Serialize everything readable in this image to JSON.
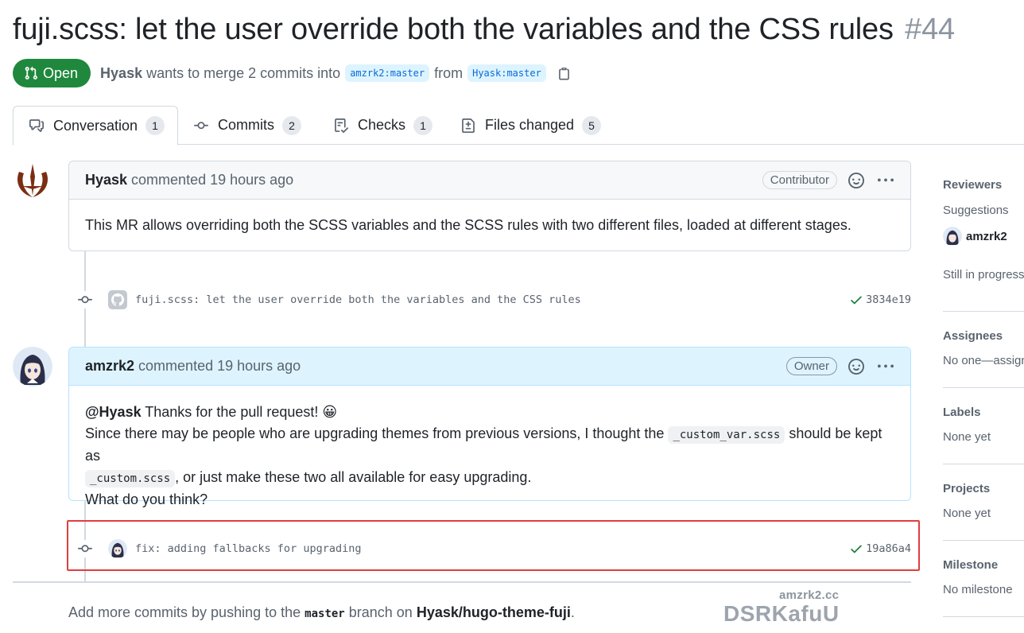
{
  "pr": {
    "title": "fuji.scss: let the user override both the variables and the CSS rules",
    "number": "#44",
    "state": "Open",
    "author": "Hyask",
    "merge_text": "wants to merge 2 commits into",
    "base_branch": "amzrk2:master",
    "from_text": "from",
    "head_branch": "Hyask:master"
  },
  "tabs": [
    {
      "label": "Conversation",
      "count": "1"
    },
    {
      "label": "Commits",
      "count": "2"
    },
    {
      "label": "Checks",
      "count": "1"
    },
    {
      "label": "Files changed",
      "count": "5"
    }
  ],
  "comments": [
    {
      "author": "Hyask",
      "action": "commented 19 hours ago",
      "role": "Contributor",
      "body": "This MR allows overriding both the SCSS variables and the SCSS rules with two different files, loaded at different stages."
    },
    {
      "author": "amzrk2",
      "action": "commented 19 hours ago",
      "role": "Owner",
      "mention": "@Hyask",
      "line1_rest": "Thanks for the pull request!",
      "emoji": "😀",
      "line2_pre": "Since there may be people who are upgrading themes from previous versions, I thought the",
      "code1": "_custom_var.scss",
      "line2_post": "should be kept as",
      "code2": "_custom.scss",
      "line3_rest": ", or just make these two all available for easy upgrading.",
      "line4": "What do you think?"
    }
  ],
  "commits": [
    {
      "message": "fuji.scss: let the user override both the variables and the CSS rules",
      "sha": "3834e19"
    },
    {
      "message": "fix: adding fallbacks for upgrading",
      "sha": "19a86a4"
    }
  ],
  "footer": {
    "pre": "Add more commits by pushing to the",
    "branch": "master",
    "mid": "branch on",
    "repo": "Hyask/hugo-theme-fuji",
    "post": "."
  },
  "watermark": {
    "small": "amzrk2.cc",
    "big": "DSRKafuU"
  },
  "sidebar": {
    "reviewers": {
      "heading": "Reviewers",
      "sub": "Suggestions",
      "user": "amzrk2",
      "status": "Still in progress"
    },
    "assignees": {
      "heading": "Assignees",
      "value": "No one—assign"
    },
    "labels": {
      "heading": "Labels",
      "value": "None yet"
    },
    "projects": {
      "heading": "Projects",
      "value": "None yet"
    },
    "milestone": {
      "heading": "Milestone",
      "value": "No milestone"
    }
  },
  "colors": {
    "open_green": "#1f883d",
    "owner_header": "#ddf4ff",
    "highlight_red": "#e03e3e"
  },
  "icons": [
    "git-pull-request-icon",
    "copy-icon",
    "comment-discussion-icon",
    "git-commit-icon",
    "checklist-icon",
    "file-diff-icon",
    "smiley-icon",
    "kebab-horizontal-icon",
    "check-icon"
  ]
}
